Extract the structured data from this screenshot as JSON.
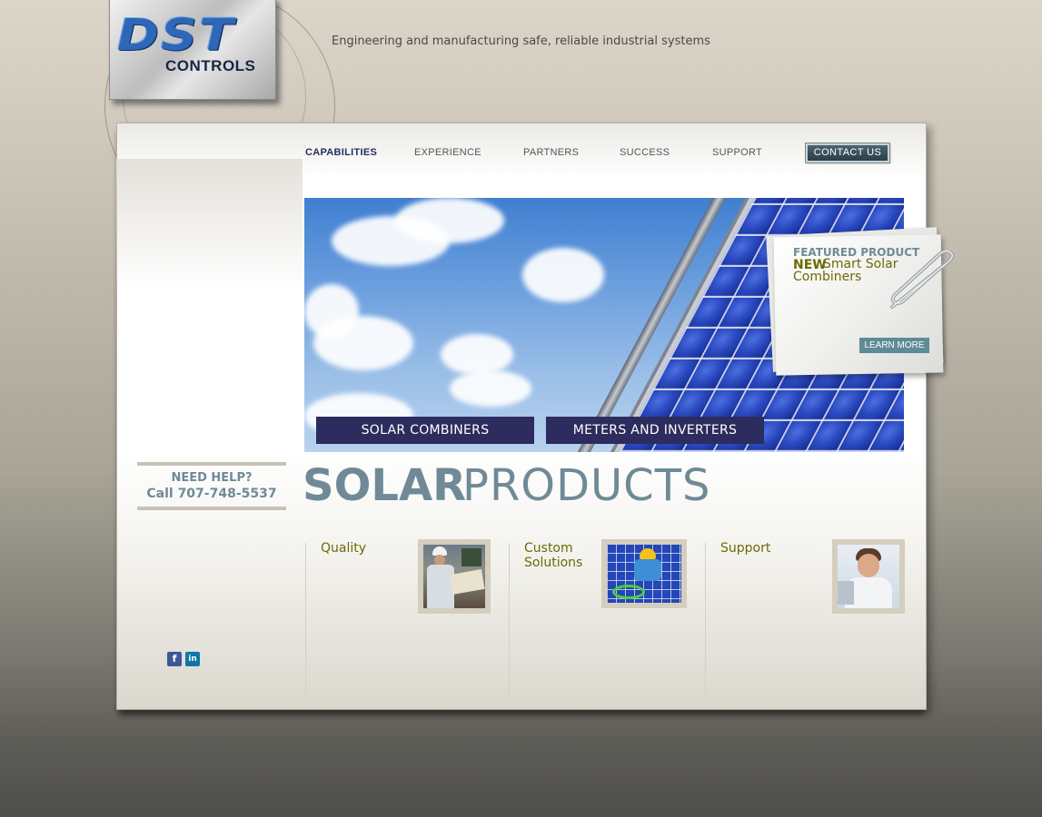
{
  "brand": {
    "logo_text": "DST",
    "logo_sub": "CONTROLS",
    "tagline": "Engineering and manufacturing safe, reliable industrial systems",
    "logo_color": "#2f67b8"
  },
  "nav": {
    "items": [
      {
        "label": "CAPABILITIES",
        "active": true
      },
      {
        "label": "EXPERIENCE"
      },
      {
        "label": "PARTNERS"
      },
      {
        "label": "SUCCESS"
      },
      {
        "label": "SUPPORT"
      }
    ],
    "contact_label": "CONTACT US"
  },
  "hero": {
    "tabs": [
      {
        "label": "SOLAR COMBINERS"
      },
      {
        "label": "METERS AND INVERTERS"
      }
    ]
  },
  "featured": {
    "heading": "FEATURED PRODUCT",
    "new_label": "NEW",
    "product_line1": "Smart Solar",
    "product_line2": "Combiners",
    "button_label": "LEARN MORE"
  },
  "help": {
    "line1": "NEED HELP?",
    "line2": "Call 707-748-5537"
  },
  "page_title": {
    "bold": "SOLAR",
    "light": "PRODUCTS"
  },
  "columns": [
    {
      "title": "Quality"
    },
    {
      "title_line1": "Custom",
      "title_line2": "Solutions"
    },
    {
      "title": "Support"
    }
  ],
  "social": {
    "facebook_label": "f",
    "linkedin_label": "in"
  },
  "colors": {
    "accent_slate": "#6f8a96",
    "olive": "#6a6a06",
    "navy": "#2d2c5e"
  },
  "icons": [
    "facebook-icon",
    "linkedin-icon",
    "paperclip-icon"
  ]
}
